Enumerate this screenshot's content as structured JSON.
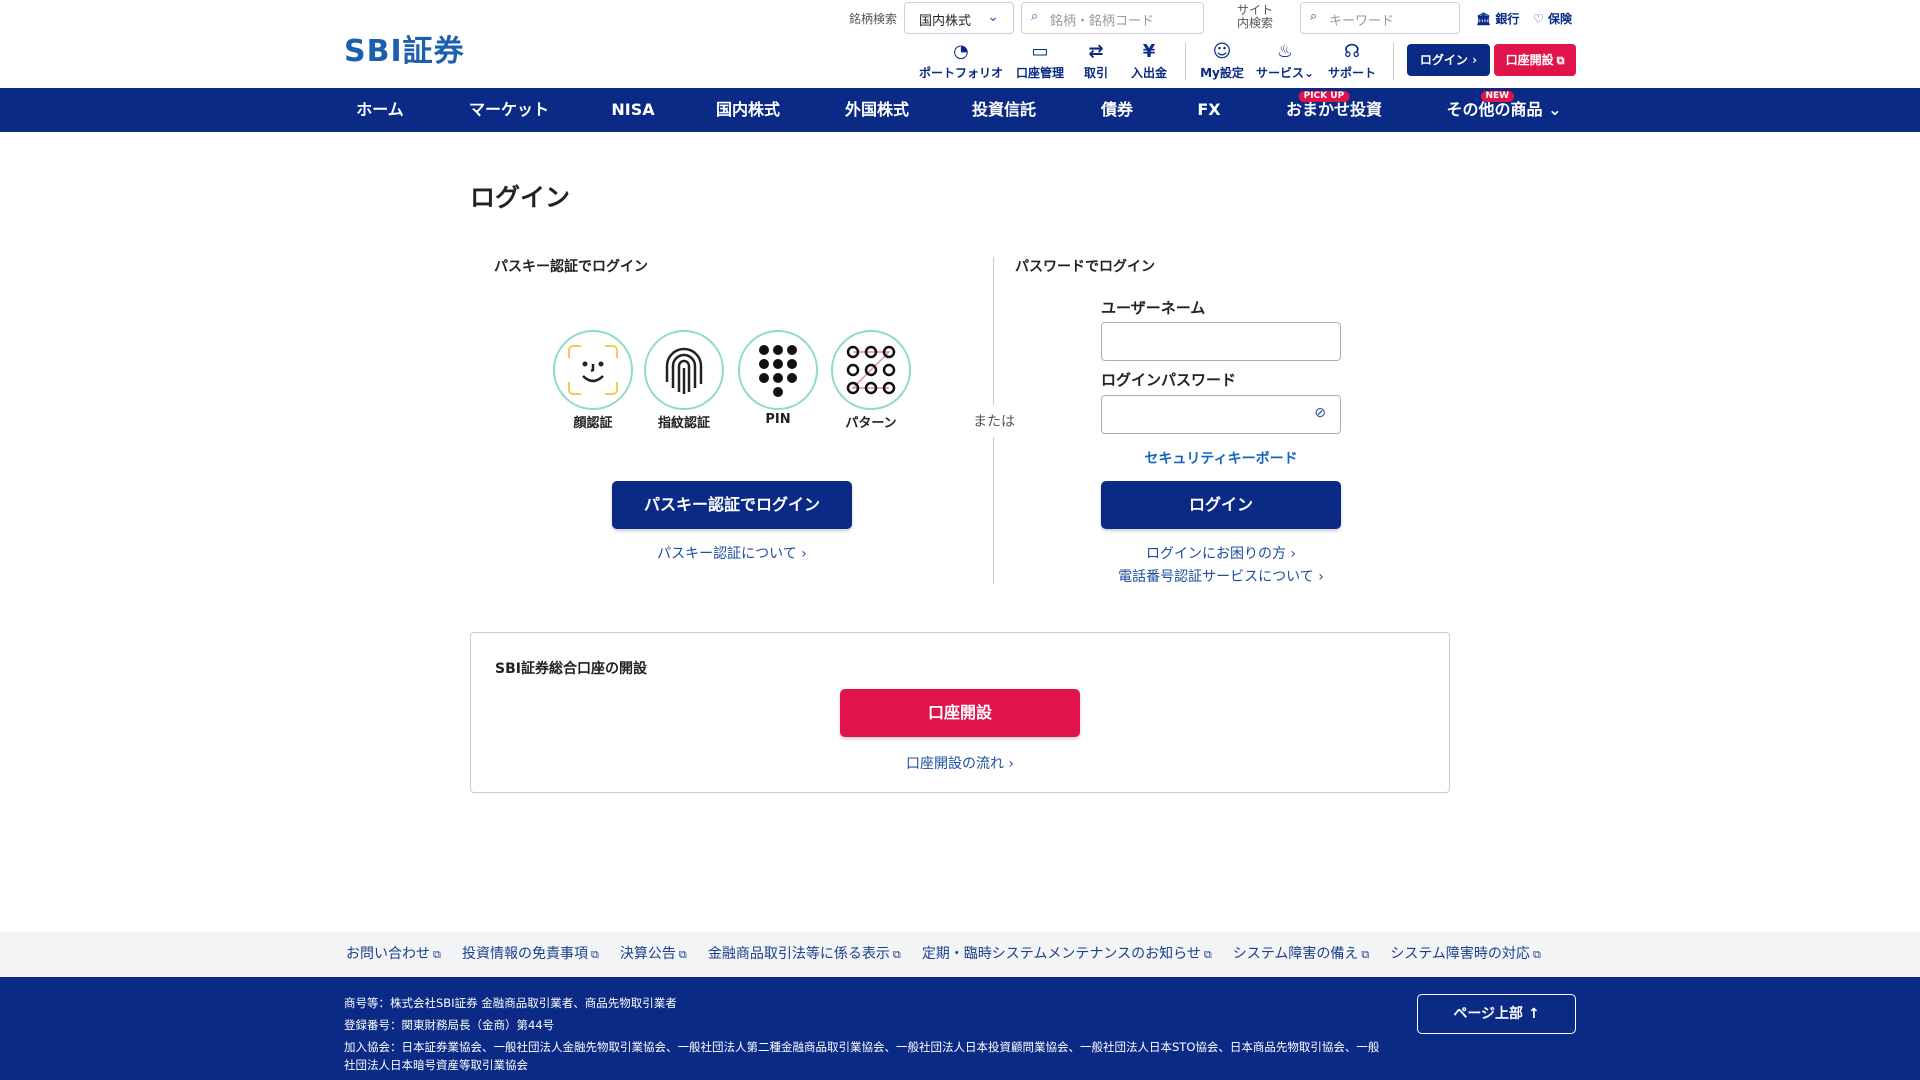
{
  "header": {
    "logo": "SBI証券",
    "stock_search_label": "銘柄検索",
    "market_select": "国内株式",
    "stock_search_placeholder": "銘柄・銘柄コード",
    "site_search_label_1": "サイト",
    "site_search_label_2": "内検索",
    "site_search_placeholder": "キーワード",
    "bank": "銀行",
    "insurance": "保険",
    "icons": [
      {
        "label": "ポートフォリオ",
        "icon": "pie-chart-icon"
      },
      {
        "label": "口座管理",
        "icon": "card-icon"
      },
      {
        "label": "取引",
        "icon": "exchange-icon"
      },
      {
        "label": "入出金",
        "icon": "yen-icon"
      },
      {
        "label": "My設定",
        "icon": "user-settings-icon"
      },
      {
        "label": "サービス",
        "icon": "hand-coin-icon"
      },
      {
        "label": "サポート",
        "icon": "headset-icon"
      }
    ],
    "login_button": "ログイン",
    "open_account_button": "口座開設"
  },
  "nav": {
    "items": [
      {
        "label": "ホーム"
      },
      {
        "label": "マーケット"
      },
      {
        "label": "NISA"
      },
      {
        "label": "国内株式"
      },
      {
        "label": "外国株式"
      },
      {
        "label": "投資信託"
      },
      {
        "label": "債券"
      },
      {
        "label": "FX"
      },
      {
        "label": "おまかせ投資",
        "badge": "PICK UP"
      },
      {
        "label": "その他の商品",
        "badge": "NEW"
      }
    ]
  },
  "main": {
    "title": "ログイン",
    "passkey": {
      "heading": "パスキー認証でログイン",
      "methods": [
        "顔認証",
        "指紋認証",
        "PIN",
        "パターン"
      ],
      "button": "パスキー認証でログイン",
      "about_link": "パスキー認証について"
    },
    "or": "または",
    "password": {
      "heading": "パスワードでログイン",
      "username_label": "ユーザーネーム",
      "username_value": "",
      "password_label": "ログインパスワード",
      "password_value": "",
      "security_keyboard": "セキュリティキーボード",
      "button": "ログイン",
      "trouble_link": "ログインにお困りの方",
      "phone_link": "電話番号認証サービスについて"
    },
    "account": {
      "heading": "SBI証券総合口座の開設",
      "button": "口座開設",
      "flow_link": "口座開設の流れ"
    }
  },
  "footer": {
    "links": [
      "お問い合わせ",
      "投資情報の免責事項",
      "決算公告",
      "金融商品取引法等に係る表示",
      "定期・臨時システムメンテナンスのお知らせ",
      "システム障害の備え",
      "システム障害時の対応"
    ],
    "company": "商号等：株式会社SBI証券 金融商品取引業者、商品先物取引業者",
    "registration": "登録番号：関東財務局長（金商）第44号",
    "associations": "加入協会：日本証券業協会、一般社団法人金融先物取引業協会、一般社団法人第二種金融商品取引業協会、一般社団法人日本投資顧問業協会、一般社団法人日本STO協会、日本商品先物取引協会、一般社団法人日本暗号資産等取引業協会",
    "page_top": "ページ上部"
  },
  "colors": {
    "navy": "#0a2a85",
    "red": "#e0134b",
    "link": "#1d4ea0"
  }
}
